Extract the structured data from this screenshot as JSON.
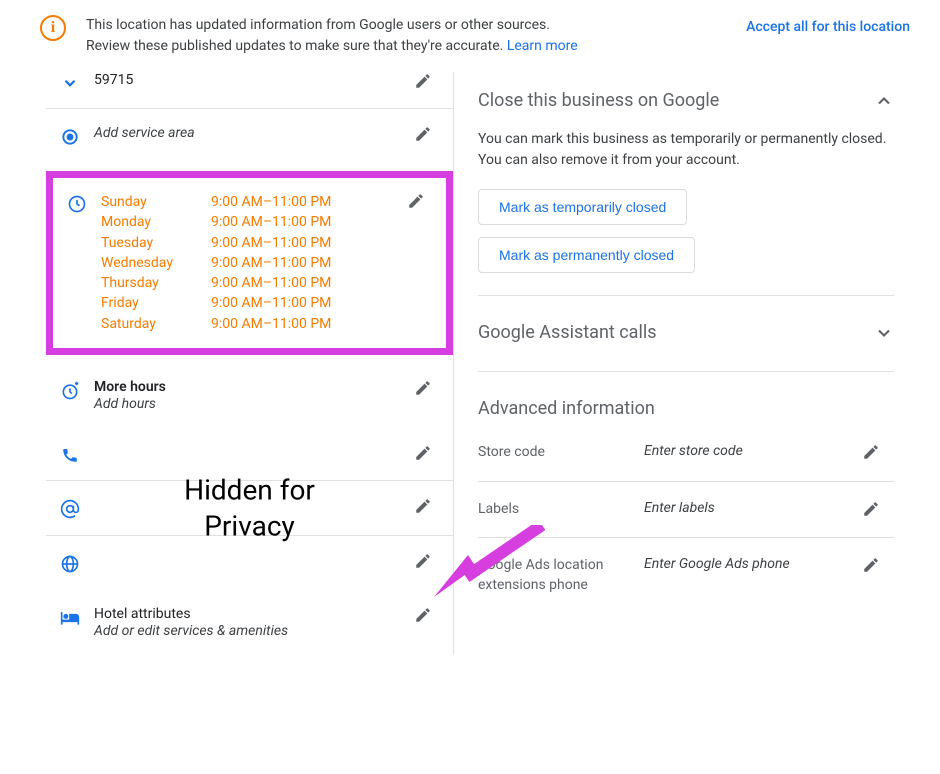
{
  "banner": {
    "line1": "This location has updated information from Google users or other sources.",
    "line2": "Review these published updates to make sure that they're accurate.",
    "learn_more": "Learn more",
    "action": "Accept all for this location"
  },
  "address": {
    "zip": "59715"
  },
  "service_area": {
    "placeholder": "Add service area"
  },
  "hours": {
    "days": [
      {
        "day": "Sunday",
        "hours": "9:00 AM–11:00 PM"
      },
      {
        "day": "Monday",
        "hours": "9:00 AM–11:00 PM"
      },
      {
        "day": "Tuesday",
        "hours": "9:00 AM–11:00 PM"
      },
      {
        "day": "Wednesday",
        "hours": "9:00 AM–11:00 PM"
      },
      {
        "day": "Thursday",
        "hours": "9:00 AM–11:00 PM"
      },
      {
        "day": "Friday",
        "hours": "9:00 AM–11:00 PM"
      },
      {
        "day": "Saturday",
        "hours": "9:00 AM–11:00 PM"
      }
    ]
  },
  "more_hours": {
    "label": "More hours",
    "sub": "Add hours"
  },
  "privacy_overlay": "Hidden for\nPrivacy",
  "hotel": {
    "label": "Hotel attributes",
    "sub": "Add or edit services & amenities"
  },
  "close": {
    "heading": "Close this business on Google",
    "desc": "You can mark this business as temporarily or permanently closed. You can also remove it from your account.",
    "temp_btn": "Mark as temporarily closed",
    "perm_btn": "Mark as permanently closed"
  },
  "assistant": {
    "heading": "Google Assistant calls"
  },
  "advanced": {
    "heading": "Advanced information",
    "store_code": {
      "label": "Store code",
      "placeholder": "Enter store code"
    },
    "labels": {
      "label": "Labels",
      "placeholder": "Enter labels"
    },
    "ads_phone": {
      "label": "Google Ads location extensions phone",
      "placeholder": "Enter Google Ads phone"
    }
  }
}
